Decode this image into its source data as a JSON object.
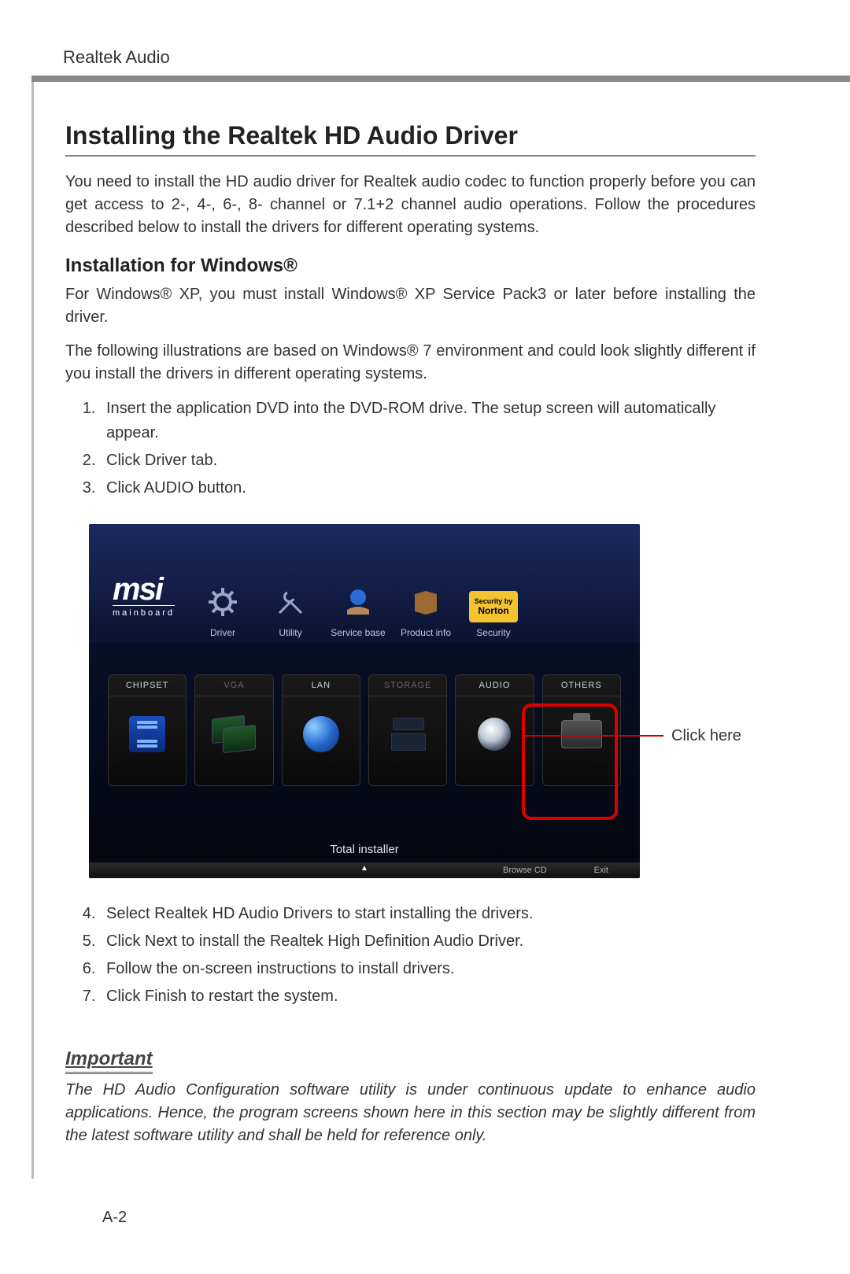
{
  "header": "Realtek Audio",
  "title": "Installing the Realtek HD Audio Driver",
  "intro": "You need to install the HD audio driver for Realtek audio codec to function properly before you can get access to 2-, 4-, 6-, 8- channel or 7.1+2 channel audio operations. Follow the procedures described below to install the drivers for different operating systems.",
  "subhead": "Installation for Windows®",
  "p_xp": "For Windows® XP, you must install Windows® XP Service Pack3 or later before installing the driver.",
  "p_win7": "The following illustrations are based on Windows® 7 environment and could look slightly different if you install the drivers in different operating systems.",
  "steps_a": [
    "Insert the application DVD into the DVD-ROM drive. The setup screen will automatically appear.",
    "Click Driver tab.",
    "Click AUDIO button."
  ],
  "screenshot": {
    "logo_main": "msi",
    "logo_sub": "mainboard",
    "top_icons": [
      "Driver",
      "Utility",
      "Service base",
      "Product info",
      "Security"
    ],
    "norton_top": "Security by",
    "norton_name": "Norton",
    "tiles": [
      "CHIPSET",
      "VGA",
      "LAN",
      "STORAGE",
      "AUDIO",
      "OTHERS"
    ],
    "highlight_index": 4,
    "total_installer": "Total installer",
    "browse": "Browse CD",
    "exit": "Exit"
  },
  "callout": "Click here",
  "steps_b": [
    "Select Realtek HD Audio Drivers to start installing the drivers.",
    "Click Next to install the Realtek High Definition Audio Driver.",
    "Follow the on-screen instructions to install drivers.",
    "Click Finish to restart the system."
  ],
  "important_label": "Important",
  "important_text": "The HD Audio Configuration software utility is under continuous update to enhance audio applications. Hence, the program screens shown here in this section may be slightly different from the latest software utility and shall be held for reference only.",
  "page_number": "A-2"
}
